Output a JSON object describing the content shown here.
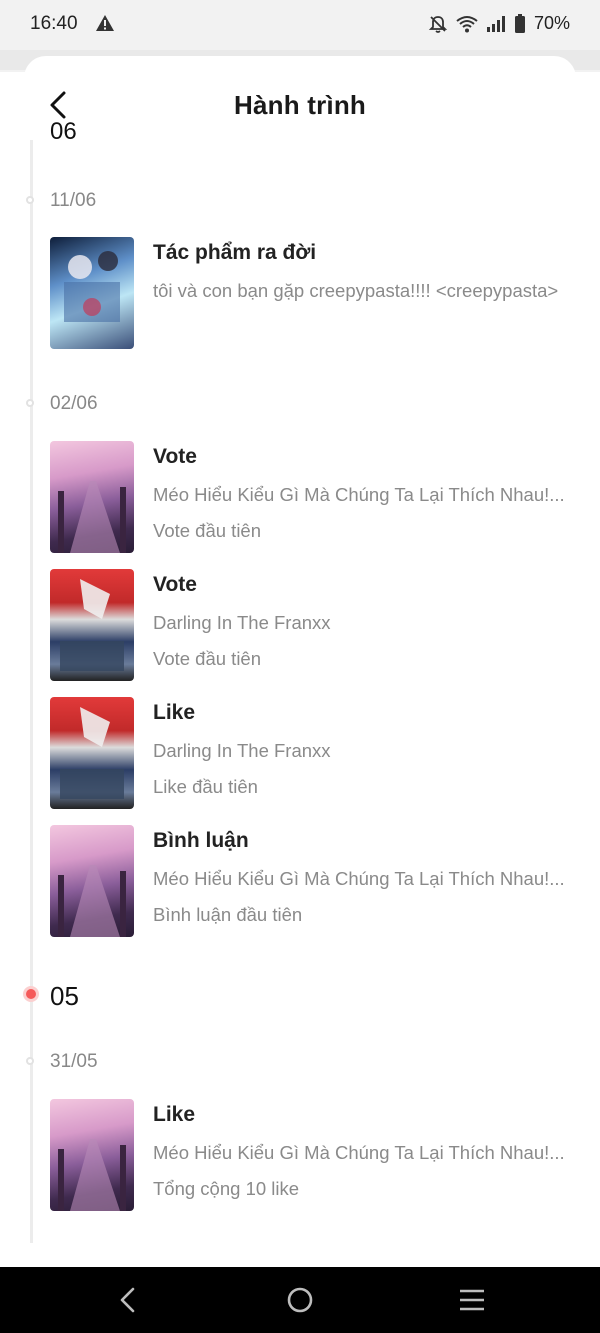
{
  "status": {
    "time": "16:40",
    "battery": "70%"
  },
  "header": {
    "title": "Hành trình"
  },
  "timeline": {
    "clipped_month": "06",
    "groups": [
      {
        "date": "11/06",
        "entries": [
          {
            "title": "Tác phẩm ra đời",
            "line1": "tôi và con bạn gặp creepypasta!!!! <creepypasta>",
            "line2": ""
          }
        ]
      },
      {
        "date": "02/06",
        "entries": [
          {
            "title": "Vote",
            "line1": "Méo Hiểu Kiểu Gì Mà Chúng Ta Lại Thích Nhau!...",
            "line2": "Vote đầu tiên"
          },
          {
            "title": "Vote",
            "line1": "Darling In The Franxx",
            "line2": "Vote đầu tiên"
          },
          {
            "title": "Like",
            "line1": "Darling In The Franxx",
            "line2": "Like đầu tiên"
          },
          {
            "title": "Bình luận",
            "line1": "Méo Hiểu Kiểu Gì Mà Chúng Ta Lại Thích Nhau!...",
            "line2": "Bình luận đầu tiên"
          }
        ]
      }
    ],
    "month": "05",
    "groups2": [
      {
        "date": "31/05",
        "entries": [
          {
            "title": "Like",
            "line1": "Méo Hiểu Kiểu Gì Mà Chúng Ta Lại Thích Nhau!...",
            "line2": "Tổng cộng 10 like"
          }
        ]
      }
    ]
  },
  "colors": {
    "month_dot": "#f55a5a",
    "timeline_line": "#ececec",
    "secondary_text": "#8a8a8a"
  },
  "icons": [
    "warning-icon",
    "bell-off-icon",
    "wifi-icon",
    "signal-icon",
    "battery-icon",
    "back-arrow-icon",
    "nav-back-icon",
    "nav-home-icon",
    "nav-menu-icon"
  ]
}
